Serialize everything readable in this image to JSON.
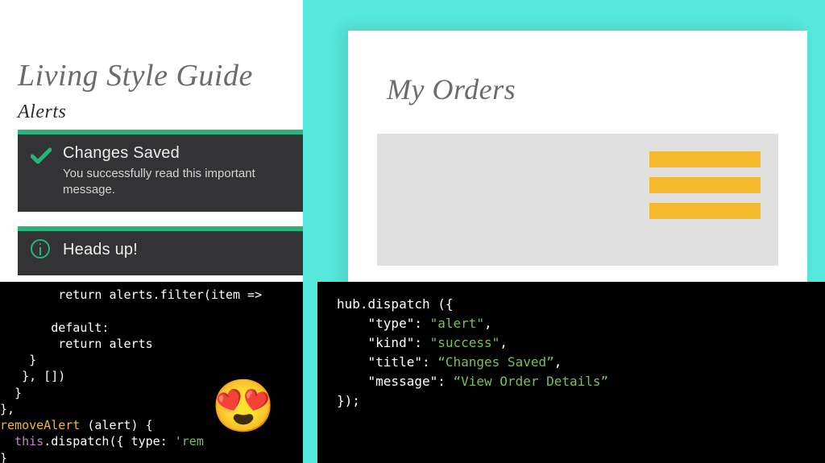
{
  "left": {
    "title": "Living Style Guide",
    "subtitle": "Alerts",
    "alerts": [
      {
        "title": "Changes Saved",
        "msg": "You successfully read this important message."
      },
      {
        "title": "Heads up!",
        "msg": ""
      }
    ]
  },
  "right": {
    "title": "My Orders"
  },
  "codeLeft": {
    "l1": "        return alerts.filter(item =>",
    "l2": "",
    "l3": "       default:",
    "l4": "        return alerts",
    "l5": "    }",
    "l6": "   }, [])",
    "l7": "  }",
    "l8": "},",
    "l9a": "removeAlert",
    "l9b": " (alert) {",
    "l10a": "  this",
    "l10b": ".dispatch({ ",
    "l10c": "type",
    "l10d": ": ",
    "l10e": "'rem",
    "l11": "}"
  },
  "codeRight": {
    "l1": "hub.dispatch ({",
    "l2a": "    \"type\"",
    "l2b": ": ",
    "l2c": "\"alert\"",
    "l2d": ",",
    "l3a": "    \"kind\"",
    "l3b": ": ",
    "l3c": "\"success\"",
    "l3d": ",",
    "l4a": "    \"title\"",
    "l4b": ": ",
    "l4c": "“Changes Saved”",
    "l4d": ",",
    "l5a": "    \"message\"",
    "l5b": ": ",
    "l5c": "“View Order Details”",
    "l6": "});"
  },
  "emoji": "😍",
  "colors": {
    "accent": "#2ab27b",
    "warn": "#f3b92a",
    "teal": "#56e8db"
  }
}
